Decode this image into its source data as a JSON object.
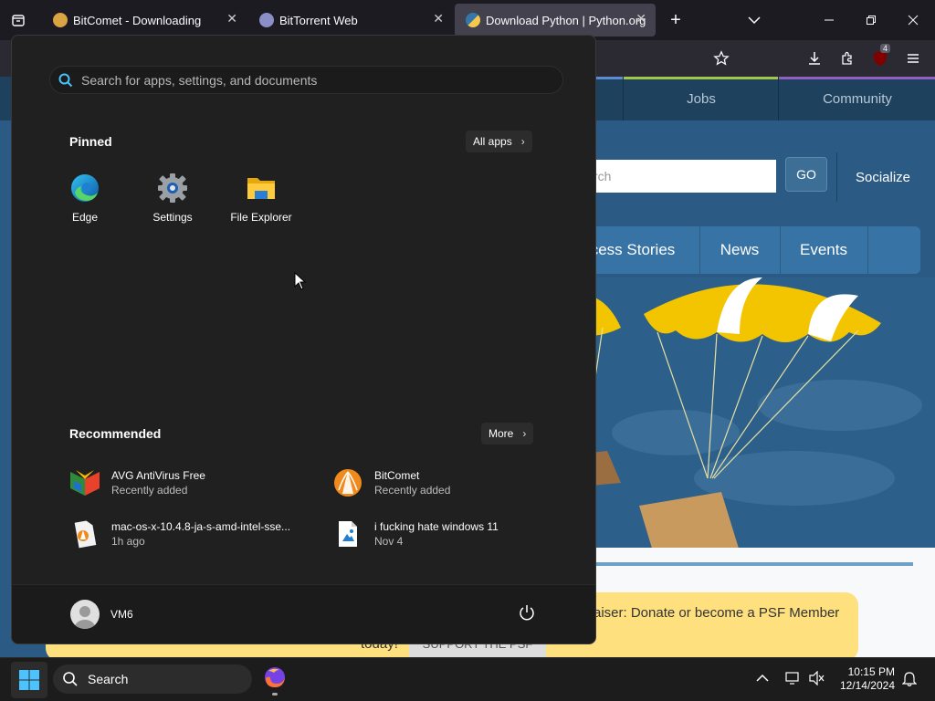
{
  "browser": {
    "tabs": [
      {
        "title": "BitComet - Downloading",
        "favicon_color": "#d9a441"
      },
      {
        "title": "BitTorrent Web",
        "favicon_color": "#8a8fc8"
      },
      {
        "title": "Download Python | Python.org",
        "favicon_color": "#f2c94c"
      }
    ],
    "extension_badge": "4"
  },
  "site": {
    "topnav": [
      "Jobs",
      "Community"
    ],
    "search_placeholder": "rch",
    "go_label": "GO",
    "socialize_label": "Socialize",
    "mainnav": [
      "cess Stories",
      "News",
      "Events"
    ],
    "psf_text": "aiser: Donate or become a PSF Member",
    "psf_text2": "today!",
    "psf_button": "SUPPORT THE PSF"
  },
  "start_menu": {
    "search_placeholder": "Search for apps, settings, and documents",
    "pinned_title": "Pinned",
    "all_apps_label": "All apps",
    "pinned": [
      {
        "label": "Edge",
        "icon": "edge-icon"
      },
      {
        "label": "Settings",
        "icon": "settings-icon"
      },
      {
        "label": "File Explorer",
        "icon": "file-explorer-icon"
      }
    ],
    "recommended_title": "Recommended",
    "more_label": "More",
    "recommended": [
      {
        "name": "AVG AntiVirus Free",
        "detail": "Recently added",
        "icon": "avg-icon"
      },
      {
        "name": "BitComet",
        "detail": "Recently added",
        "icon": "bitcomet-icon"
      },
      {
        "name": "mac-os-x-10.4.8-ja-s-amd-intel-sse...",
        "detail": "1h ago",
        "icon": "torrent-file-icon"
      },
      {
        "name": "i fucking hate windows 11",
        "detail": "Nov 4",
        "icon": "image-file-icon"
      }
    ],
    "user_name": "VM6"
  },
  "taskbar": {
    "search_label": "Search",
    "time": "10:15 PM",
    "date": "12/14/2024"
  }
}
